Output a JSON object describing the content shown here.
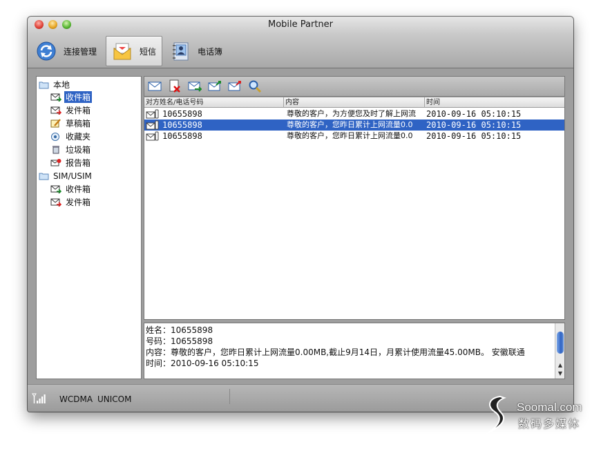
{
  "window": {
    "title": "Mobile Partner"
  },
  "toolbar": {
    "connection_label": "连接管理",
    "sms_label": "短信",
    "phonebook_label": "电话簿"
  },
  "sidebar": {
    "local_label": "本地",
    "local_items": [
      {
        "label": "收件箱",
        "icon": "inbox-icon",
        "selected": true
      },
      {
        "label": "发件箱",
        "icon": "outbox-icon"
      },
      {
        "label": "草稿箱",
        "icon": "drafts-icon"
      },
      {
        "label": "收藏夹",
        "icon": "favorites-icon"
      },
      {
        "label": "垃圾箱",
        "icon": "trash-icon"
      },
      {
        "label": "报告箱",
        "icon": "report-icon"
      }
    ],
    "sim_label": "SIM/USIM",
    "sim_items": [
      {
        "label": "收件箱",
        "icon": "inbox-icon"
      },
      {
        "label": "发件箱",
        "icon": "outbox-icon"
      }
    ]
  },
  "message_toolbar": {
    "icons": [
      "new-message-icon",
      "delete-message-icon",
      "reply-icon",
      "forward-icon",
      "resend-icon",
      "search-icon"
    ]
  },
  "list": {
    "columns": [
      "对方姓名/电话号码",
      "内容",
      "时间"
    ],
    "rows": [
      {
        "number": "10655898",
        "content": "尊敬的客户，为方便您及时了解上网流",
        "time": "2010-09-16 05:10:15"
      },
      {
        "number": "10655898",
        "content": "尊敬的客户，您昨日累计上网流量0.0",
        "time": "2010-09-16 05:10:15",
        "selected": true
      },
      {
        "number": "10655898",
        "content": "尊敬的客户，您昨日累计上网流量0.0",
        "time": "2010-09-16 05:10:15"
      }
    ]
  },
  "detail": {
    "name_line": "姓名：10655898",
    "number_line": "号码：10655898",
    "content_line": "内容：尊敬的客户，您昨日累计上网流量0.00MB,截止9月14日，月累计使用流量45.00MB。 安徽联通",
    "time_line": "时间：2010-09-16 05:10:15"
  },
  "status": {
    "network": "WCDMA",
    "operator": "UNICOM"
  },
  "watermark": {
    "site": "Soomal.com",
    "sub": "数码多媒体"
  },
  "colors": {
    "selection": "#2f63c4",
    "window_chrome": "#9e9e9e"
  }
}
